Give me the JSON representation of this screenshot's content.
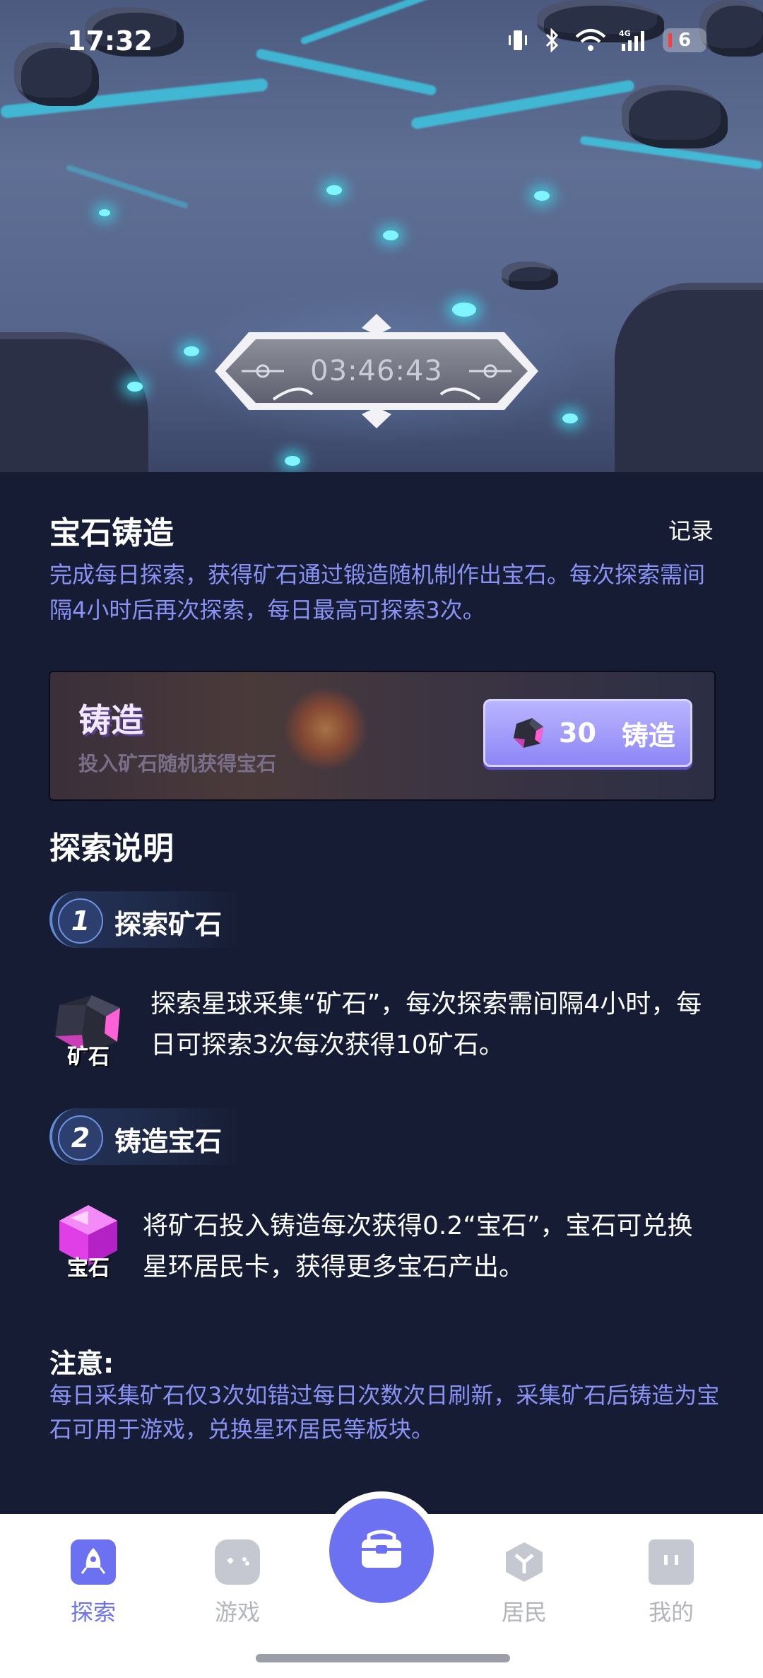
{
  "status_bar": {
    "time": "17:32",
    "network": "4G",
    "battery": "6",
    "icons": [
      "vibrate-icon",
      "bluetooth-icon",
      "wifi-icon",
      "signal-icon",
      "battery-icon"
    ]
  },
  "hero": {
    "countdown": "03:46:43"
  },
  "header": {
    "title": "宝石铸造",
    "record_link": "记录",
    "description": "完成每日探索，获得矿石通过锻造随机制作出宝石。每次探索需间隔4小时后再次探索，每日最高可探索3次。"
  },
  "forge": {
    "label": "铸造",
    "subtitle": "投入矿石随机获得宝石",
    "cost": "30",
    "button_label": "铸造"
  },
  "explanation": {
    "title": "探索说明",
    "steps": [
      {
        "number": "1",
        "label": "探索矿石",
        "icon_caption": "矿石",
        "text": "探索星球采集“矿石”，每次探索需间隔4小时，每日可探索3次每次获得10矿石。"
      },
      {
        "number": "2",
        "label": "铸造宝石",
        "icon_caption": "宝石",
        "text": "将矿石投入铸造每次获得0.2“宝石”，宝石可兑换星环居民卡，获得更多宝石产出。"
      }
    ]
  },
  "note": {
    "title": "注意:",
    "text": "每日采集矿石仅3次如错过每日次数次日刷新，采集矿石后铸造为宝石可用于游戏，兑换星环居民等板块。"
  },
  "bottom_nav": {
    "items": [
      {
        "label": "探索",
        "icon": "rocket-icon",
        "active": true
      },
      {
        "label": "游戏",
        "icon": "gamepad-icon",
        "active": false
      },
      {
        "label": "",
        "icon": "treasure-chest-icon",
        "active": false
      },
      {
        "label": "居民",
        "icon": "shield-icon",
        "active": false
      },
      {
        "label": "我的",
        "icon": "profile-icon",
        "active": false
      }
    ]
  },
  "colors": {
    "accent": "#6b71f0",
    "description_text": "#8a93f5",
    "panel_background": "#161c33"
  }
}
